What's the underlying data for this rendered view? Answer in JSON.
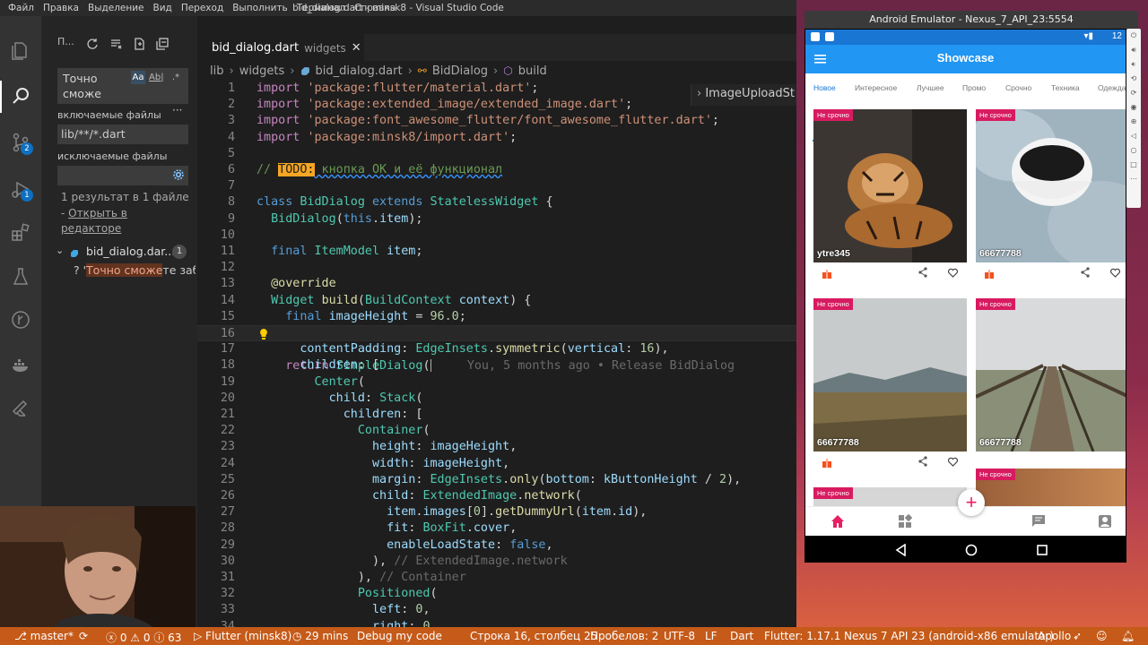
{
  "window": {
    "title": "bid_dialog.dart - minsk8 - Visual Studio Code",
    "menu": [
      "Файл",
      "Правка",
      "Выделение",
      "Вид",
      "Переход",
      "Выполнить",
      "Терминал",
      "Справка"
    ]
  },
  "activity_bar": {
    "scm_badge": "2",
    "debug_badge": "1"
  },
  "sidebar": {
    "header": "П...",
    "search_text": "Точно сможе",
    "search_options": [
      "Aa",
      "Ab|",
      ".*"
    ],
    "include_label": "включаемые файлы",
    "include_value": "lib/**/*.dart",
    "exclude_label": "исключаемые файлы",
    "result_summary": "1 результат в 1 файле",
    "open_in_editor_prefix": "- ",
    "open_in_editor": "Открыть в редакторе",
    "file_name": "bid_dialog.dar...",
    "file_count": "1",
    "match_prefix": "? '",
    "match_highlight": "Точно сможе",
    "match_suffix": "те заб..."
  },
  "tabs": [
    {
      "label": "bid_dialog.dart",
      "path_hint": "widgets"
    }
  ],
  "breadcrumb": [
    "lib",
    "widgets",
    "bid_dialog.dart",
    "BidDialog",
    "build"
  ],
  "outline_popup": "ImageUploadSt",
  "editor": {
    "current_line": 16,
    "blame": "You, 5 months ago • Release BidDialog",
    "todo_tag": "TODO:",
    "todo_text": " кнопка ОК и её функционал"
  },
  "status_bar": {
    "branch": "master*",
    "errors": "0",
    "warnings": "0",
    "info": "63",
    "flutter_project": "Flutter (minsk8)",
    "timer": "29 mins",
    "debug": "Debug my code",
    "cursor": "Строка 16, столбец 25",
    "spaces": "Пробелов: 2",
    "encoding": "UTF-8",
    "eol": "LF",
    "language": "Dart",
    "flutter_version": "Flutter: 1.17.1",
    "device": "Nexus 7 API 23 (android-x86 emulator)",
    "apollo": "Apollo"
  },
  "emulator": {
    "title": "Android Emulator - Nexus_7_API_23:5554",
    "clock": "12",
    "app_title": "Showcase",
    "tabs": [
      "Новое",
      "Интересное",
      "Лучшее",
      "Промо",
      "Срочно",
      "Техника",
      "Одежда"
    ],
    "active_tab": "Новое",
    "urgent_label": "Не срочно",
    "cards": [
      {
        "name": "ytre345"
      },
      {
        "name": "66677788"
      },
      {
        "name": "66677788"
      },
      {
        "name": "66677788"
      }
    ],
    "fab": "+"
  },
  "colors": {
    "status_bar": "#c55a19",
    "editor_bg": "#1e1e1e",
    "app_bar": "#2196f3",
    "accent_pink": "#e91e63"
  }
}
